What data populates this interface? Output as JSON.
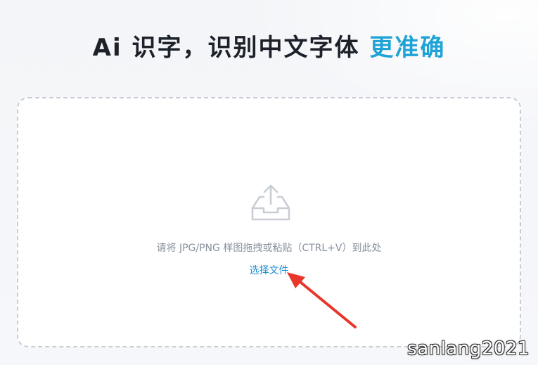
{
  "header": {
    "title_main": "Ai 识字，识别中文字体 ",
    "title_accent": "更准确"
  },
  "dropzone": {
    "hint": "请将 JPG/PNG 样图拖拽或粘贴（CTRL+V）到此处",
    "choose_file_label": "选择文件",
    "icon": "upload-tray-icon"
  },
  "annotation": {
    "arrow_color": "#e8362a"
  },
  "watermark": {
    "text": "sanlang2021"
  },
  "colors": {
    "accent": "#1fa3d6",
    "link": "#1b8fd0",
    "hint": "#86909c",
    "border": "#c9cdd4"
  }
}
